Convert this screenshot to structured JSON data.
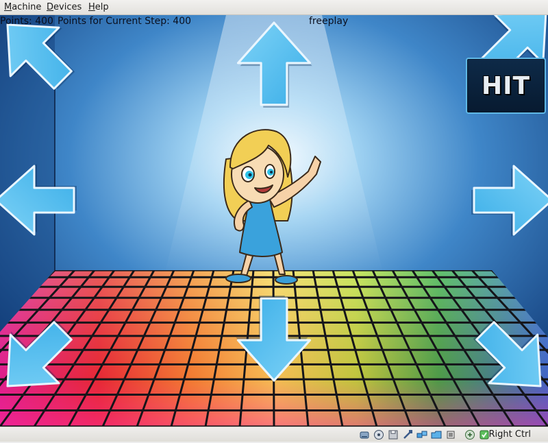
{
  "menu": {
    "items": [
      "Machine",
      "Devices",
      "Help"
    ]
  },
  "hud": {
    "points_text": "Points: 400",
    "step_points_text": "Points for Current Step: 400",
    "mode_text": "freeplay"
  },
  "hit_button": {
    "label": "HIT"
  },
  "arrows": [
    "up-left",
    "up",
    "up-right",
    "left",
    "right",
    "down-left",
    "down",
    "down-right"
  ],
  "status_bar": {
    "icons": [
      "hard-disk-icon",
      "optical-drive-icon",
      "floppy-icon",
      "usb-icon",
      "network-icon",
      "shared-folders-icon",
      "cpu-virtualization-icon",
      "mouse-integration-icon",
      "host-key-icon"
    ],
    "host_key": "Right Ctrl"
  },
  "colors": {
    "arrow_fill": "#52bdf0",
    "background": "#0f3d78",
    "hit_border": "#5fb8e6"
  }
}
